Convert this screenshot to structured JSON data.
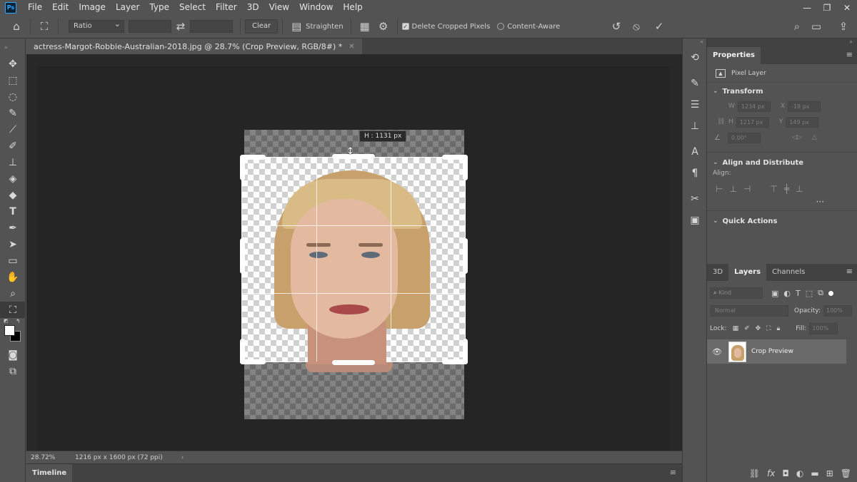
{
  "app": {
    "logo": "Ps"
  },
  "menu": [
    "File",
    "Edit",
    "Image",
    "Layer",
    "Type",
    "Select",
    "Filter",
    "3D",
    "View",
    "Window",
    "Help"
  ],
  "window_controls": {
    "minimize": "—",
    "restore": "❐",
    "close": "✕"
  },
  "options_bar": {
    "ratio_select": "Ratio",
    "swap_icon": "⇄",
    "clear_label": "Clear",
    "straighten_label": "Straighten",
    "delete_cropped_label": "Delete Cropped Pixels",
    "delete_cropped_checked": true,
    "content_aware_label": "Content-Aware",
    "content_aware_checked": false
  },
  "document": {
    "tab_title": "actress-Margot-Robbie-Australian-2018.jpg @ 28.7% (Crop Preview, RGB/8#) *",
    "height_tooltip": "H :  1131 px"
  },
  "status": {
    "zoom": "28.72%",
    "doc_info": "1216 px x 1600 px (72 ppi)",
    "arrow": "›"
  },
  "timeline": {
    "label": "Timeline"
  },
  "properties": {
    "tab": "Properties",
    "layer_kind": "Pixel Layer",
    "transform": {
      "title": "Transform",
      "w_label": "W",
      "w_value": "1234 px",
      "x_label": "X",
      "x_value": "-18 px",
      "h_label": "H",
      "h_value": "1217 px",
      "y_label": "Y",
      "y_value": "149 px",
      "angle_value": "0.00°"
    },
    "align": {
      "title": "Align and Distribute",
      "label": "Align:"
    },
    "quick_actions": {
      "title": "Quick Actions"
    }
  },
  "layers_panel": {
    "tabs": [
      "3D",
      "Layers",
      "Channels"
    ],
    "active_tab": "Layers",
    "filter_placeholder": "Kind",
    "blend_mode": "Normal",
    "opacity_label": "Opacity:",
    "opacity_value": "100%",
    "lock_label": "Lock:",
    "fill_label": "Fill:",
    "fill_value": "100%",
    "layers": [
      {
        "name": "Crop Preview",
        "visible": true
      }
    ]
  }
}
